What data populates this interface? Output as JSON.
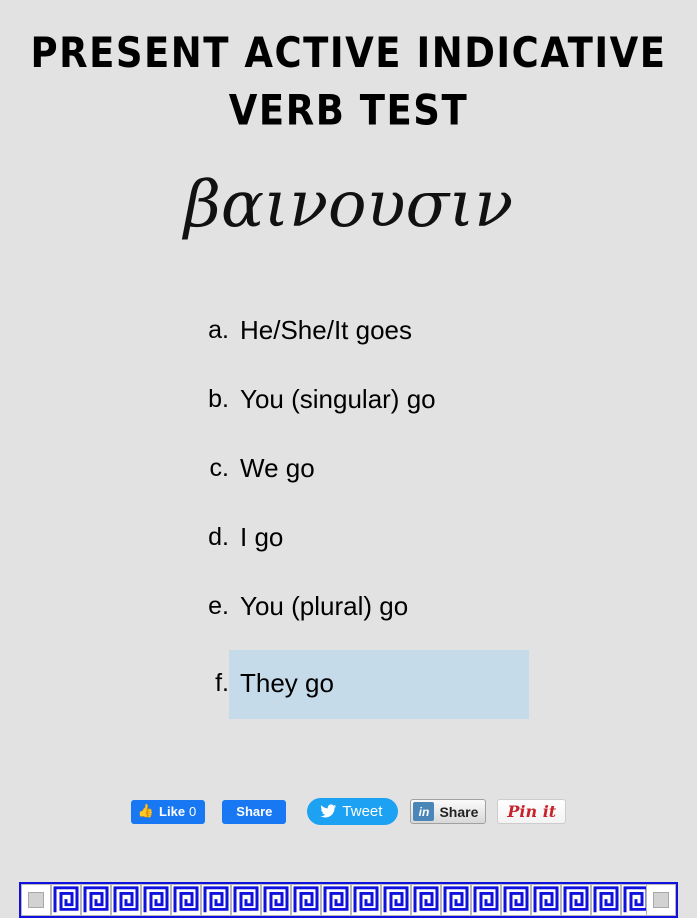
{
  "page": {
    "title": "PRESENT ACTIVE INDICATIVE VERB TEST",
    "background_color": "#e2e2e2"
  },
  "question": {
    "greek_word": "βαινουσιν",
    "selected_option": "f",
    "highlight_color": "#c5dbea",
    "options": [
      {
        "marker": "a.",
        "text": "He/She/It goes",
        "selected": false
      },
      {
        "marker": "b.",
        "text": "You (singular) go",
        "selected": false
      },
      {
        "marker": "c.",
        "text": "We go",
        "selected": false
      },
      {
        "marker": "d.",
        "text": "I go",
        "selected": false
      },
      {
        "marker": "e.",
        "text": "You (plural) go",
        "selected": false
      },
      {
        "marker": "f.",
        "text": "They go",
        "selected": true
      }
    ]
  },
  "social": {
    "facebook_like": {
      "label": "Like",
      "count": "0",
      "icon": "thumbs-up-icon",
      "color": "#1877f2"
    },
    "facebook_share": {
      "label": "Share",
      "color": "#1877f2"
    },
    "twitter": {
      "label": "Tweet",
      "icon": "twitter-bird-icon",
      "color": "#1da1f2"
    },
    "linkedin": {
      "label": "Share",
      "badge": "in",
      "color": "#4a86b8"
    },
    "pinterest": {
      "label": "Pin it",
      "color": "#c8232c"
    }
  },
  "decoration": {
    "border_name": "greek-key-meander",
    "border_color": "#1111dd",
    "unit_count": 25
  }
}
